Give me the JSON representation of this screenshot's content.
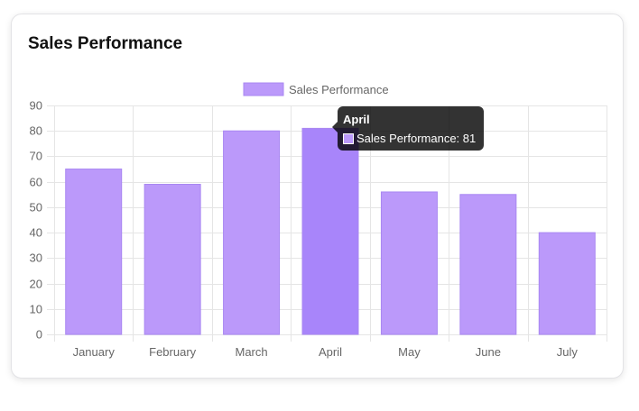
{
  "card": {
    "title": "Sales Performance"
  },
  "colors": {
    "bar_fill": "#bb99fa",
    "bar_stroke": "#a987f2",
    "bar_hover_fill": "#a885fa",
    "grid": "#e5e5e5",
    "tick_text": "#666666",
    "tooltip_bg": "rgba(0,0,0,0.8)"
  },
  "chart_data": {
    "type": "bar",
    "title": "",
    "xlabel": "",
    "ylabel": "",
    "categories": [
      "January",
      "February",
      "March",
      "April",
      "May",
      "June",
      "July"
    ],
    "series": [
      {
        "name": "Sales Performance",
        "values": [
          65,
          59,
          80,
          81,
          56,
          55,
          40
        ]
      }
    ],
    "ylim": [
      0,
      90
    ],
    "y_ticks": [
      0,
      10,
      20,
      30,
      40,
      50,
      60,
      70,
      80,
      90
    ],
    "grid": true,
    "legend": {
      "position": "top",
      "labels": [
        "Sales Performance"
      ]
    },
    "highlighted_category": "April"
  },
  "tooltip": {
    "title": "April",
    "label": "Sales Performance: 81"
  }
}
